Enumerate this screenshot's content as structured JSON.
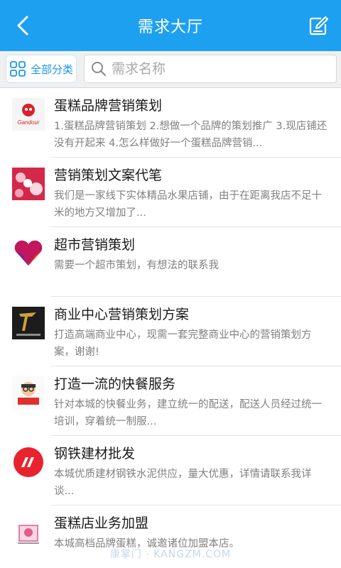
{
  "header": {
    "title": "需求大厅"
  },
  "filter": {
    "category_label": "全部分类",
    "search_placeholder": "需求名称"
  },
  "items": [
    {
      "title": "蛋糕品牌营销策划",
      "desc": "1.蛋糕品牌营销策划 2.想做一个品牌的策划推广 3.现店铺还没有开起来 4.怎么样做好一个蛋糕品牌营销...",
      "logo_text": "Gandour"
    },
    {
      "title": "营销策划文案代笔",
      "desc": "我们是一家线下实体精品水果店铺，由于在距离我店不足十米的地方又增加了...",
      "logo_text": ""
    },
    {
      "title": "超市营销策划",
      "desc": "需要一个超市策划，有想法的联系我",
      "logo_text": ""
    },
    {
      "title": "商业中心营销策划方案",
      "desc": "打造高端商业中心，现需一套完整商业中心的营销策划方案，谢谢!",
      "logo_text": ""
    },
    {
      "title": "打造一流的快餐服务",
      "desc": "针对本城的快餐业务，建立统一的配送，配送人员经过统一培训，穿着统一制服...",
      "logo_text": ""
    },
    {
      "title": "钢铁建材批发",
      "desc": "本城优质建材钢铁水泥供应，量大优惠，详情请联系我详谈...",
      "logo_text": ""
    },
    {
      "title": "蛋糕店业务加盟",
      "desc": "本城高档品牌蛋糕，诚邀诸位加盟本店。",
      "logo_text": ""
    }
  ],
  "watermark": "康掌门 · KANGZM.COM",
  "colors": {
    "header_bg": "#1ea0f0",
    "accent": "#1a96e6"
  }
}
